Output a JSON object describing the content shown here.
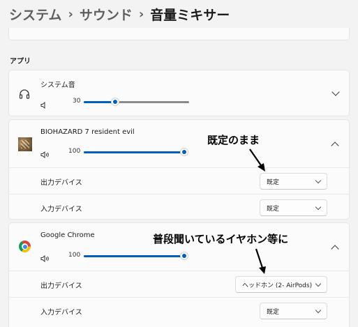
{
  "breadcrumb": {
    "root": "システム",
    "parent": "サウンド",
    "current": "音量ミキサー"
  },
  "section_label": "アプリ",
  "system_sounds": {
    "name": "システム音",
    "icon": "headphones-icon",
    "volume": "30",
    "level": 0.3
  },
  "biohazard": {
    "name": "BIOHAZARD 7 resident evil",
    "icon": "album-art-icon",
    "volume": "100",
    "level": 1.0,
    "output_label": "出力デバイス",
    "output_value": "既定",
    "input_label": "入力デバイス",
    "input_value": "既定"
  },
  "chrome": {
    "name": "Google Chrome",
    "icon": "chrome-icon",
    "volume": "100",
    "level": 1.0,
    "output_label": "出力デバイス",
    "output_value": "ヘッドホン (2- AirPods)",
    "input_label": "入力デバイス",
    "input_value": "既定"
  },
  "annotations": {
    "default_note": "既定のまま",
    "earphone_note": "普段聞いているイヤホン等に"
  },
  "colors": {
    "accent": "#005fb8",
    "background": "#f3f3f3",
    "card": "#fbfbfb"
  }
}
